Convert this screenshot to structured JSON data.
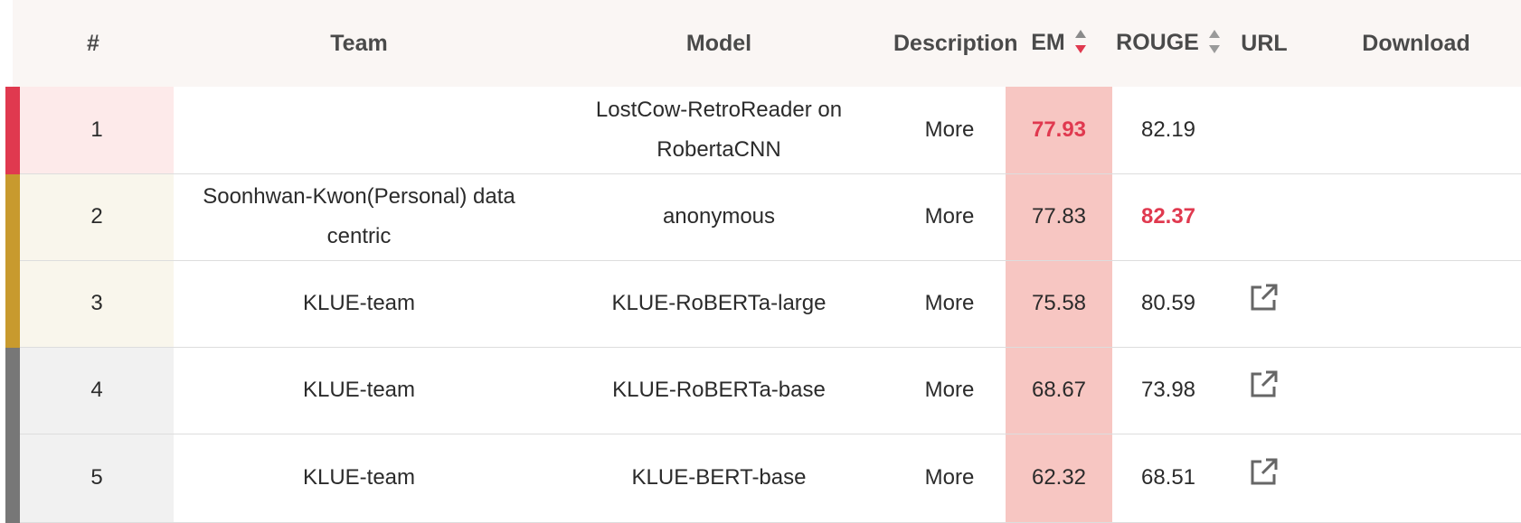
{
  "columns": [
    {
      "key": "rank",
      "label": "#"
    },
    {
      "key": "team",
      "label": "Team"
    },
    {
      "key": "model",
      "label": "Model"
    },
    {
      "key": "description",
      "label": "Description"
    },
    {
      "key": "em",
      "label": "EM"
    },
    {
      "key": "rouge",
      "label": "ROUGE"
    },
    {
      "key": "url",
      "label": "URL"
    },
    {
      "key": "download",
      "label": "Download"
    }
  ],
  "sort_state": {
    "em": "descending",
    "rouge": "none"
  },
  "colors": {
    "gold": "#e0394f",
    "silver": "#c89a2e",
    "other": "#777777",
    "highlight": "#e0394f",
    "em_column": "#f7c6c2"
  },
  "rows": [
    {
      "rank": "1",
      "team": "",
      "model": "LostCow-RetroReader on RobertaCNN",
      "description": "More",
      "em": "77.93",
      "rouge": "82.19",
      "url_icon": false,
      "tier": "first"
    },
    {
      "rank": "2",
      "team": "Soonhwan-Kwon(Personal) data centric",
      "model": "anonymous",
      "description": "More",
      "em": "77.83",
      "rouge": "82.37",
      "url_icon": false,
      "tier": "second"
    },
    {
      "rank": "3",
      "team": "KLUE-team",
      "model": "KLUE-RoBERTa-large",
      "description": "More",
      "em": "75.58",
      "rouge": "80.59",
      "url_icon": "external-link-icon",
      "tier": "second"
    },
    {
      "rank": "4",
      "team": "KLUE-team",
      "model": "KLUE-RoBERTa-base",
      "description": "More",
      "em": "68.67",
      "rouge": "73.98",
      "url_icon": "external-link-icon",
      "tier": "other"
    },
    {
      "rank": "5",
      "team": "KLUE-team",
      "model": "KLUE-BERT-base",
      "description": "More",
      "em": "62.32",
      "rouge": "68.51",
      "url_icon": "external-link-icon",
      "tier": "other"
    }
  ]
}
